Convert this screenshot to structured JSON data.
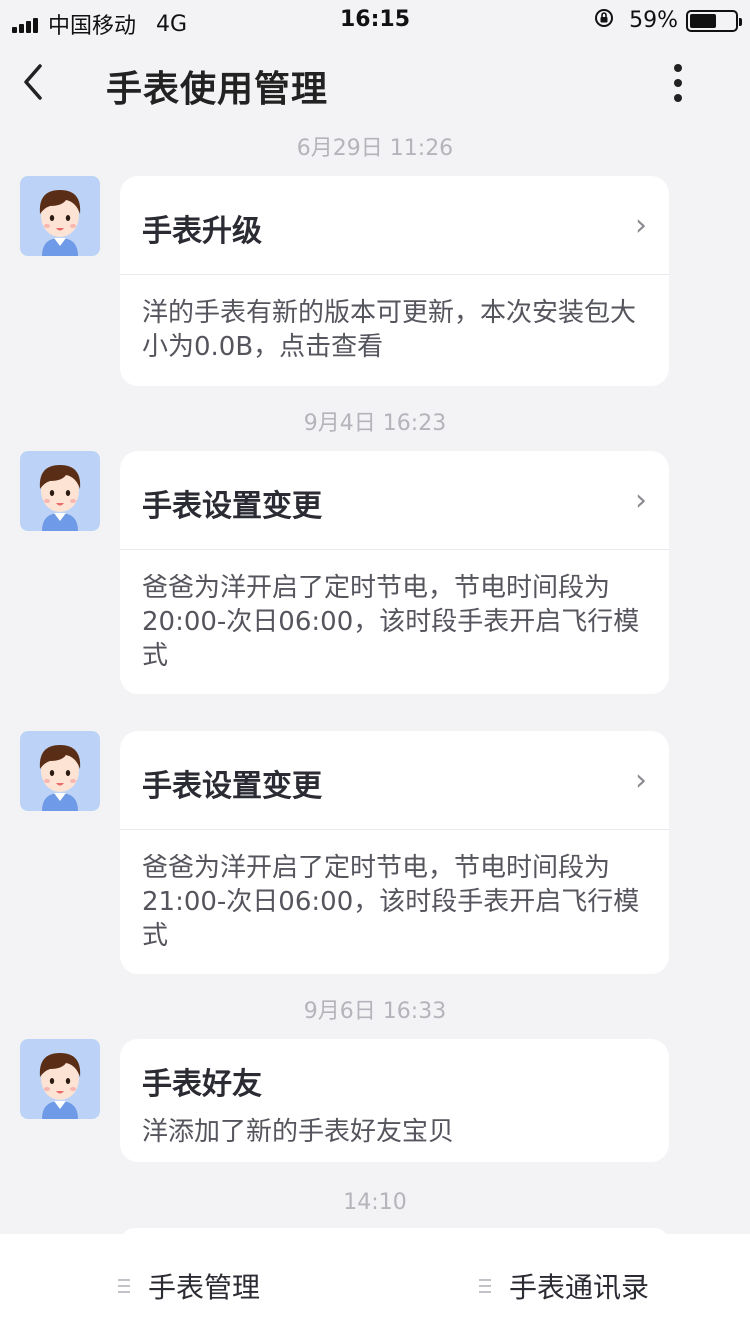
{
  "status_bar": {
    "carrier": "中国移动",
    "network": "4G",
    "time": "16:15",
    "battery_text": "59%",
    "battery_level": 0.59
  },
  "nav": {
    "title": "手表使用管理",
    "back_icon": "chevron-left-icon",
    "more_icon": "more-vertical-icon"
  },
  "messages": [
    {
      "timestamp": "6月29日 11:26",
      "title": "手表升级",
      "has_chevron": true,
      "body": "洋的手表有新的版本可更新，本次安装包大小为0.0B，点击查看"
    },
    {
      "timestamp": "9月4日 16:23",
      "title": "手表设置变更",
      "has_chevron": true,
      "body": "爸爸为洋开启了定时节电，节电时间段为20:00-次日06:00，该时段手表开启飞行模式"
    },
    {
      "timestamp": "",
      "title": "手表设置变更",
      "has_chevron": true,
      "body": "爸爸为洋开启了定时节电，节电时间段为21:00-次日06:00，该时段手表开启飞行模式"
    },
    {
      "timestamp": "9月6日 16:33",
      "title": "手表好友",
      "has_chevron": false,
      "body": "洋添加了新的手表好友宝贝"
    }
  ],
  "trailing_timestamp": "14:10",
  "chevron_glyph": "›",
  "bottom_bar": {
    "left_label": "手表管理",
    "right_label": "手表通讯录"
  },
  "colors": {
    "background": "#f3f3f6",
    "card": "#ffffff",
    "avatar_bg": "#bcd3f7",
    "timestamp": "#b4b4bb"
  }
}
